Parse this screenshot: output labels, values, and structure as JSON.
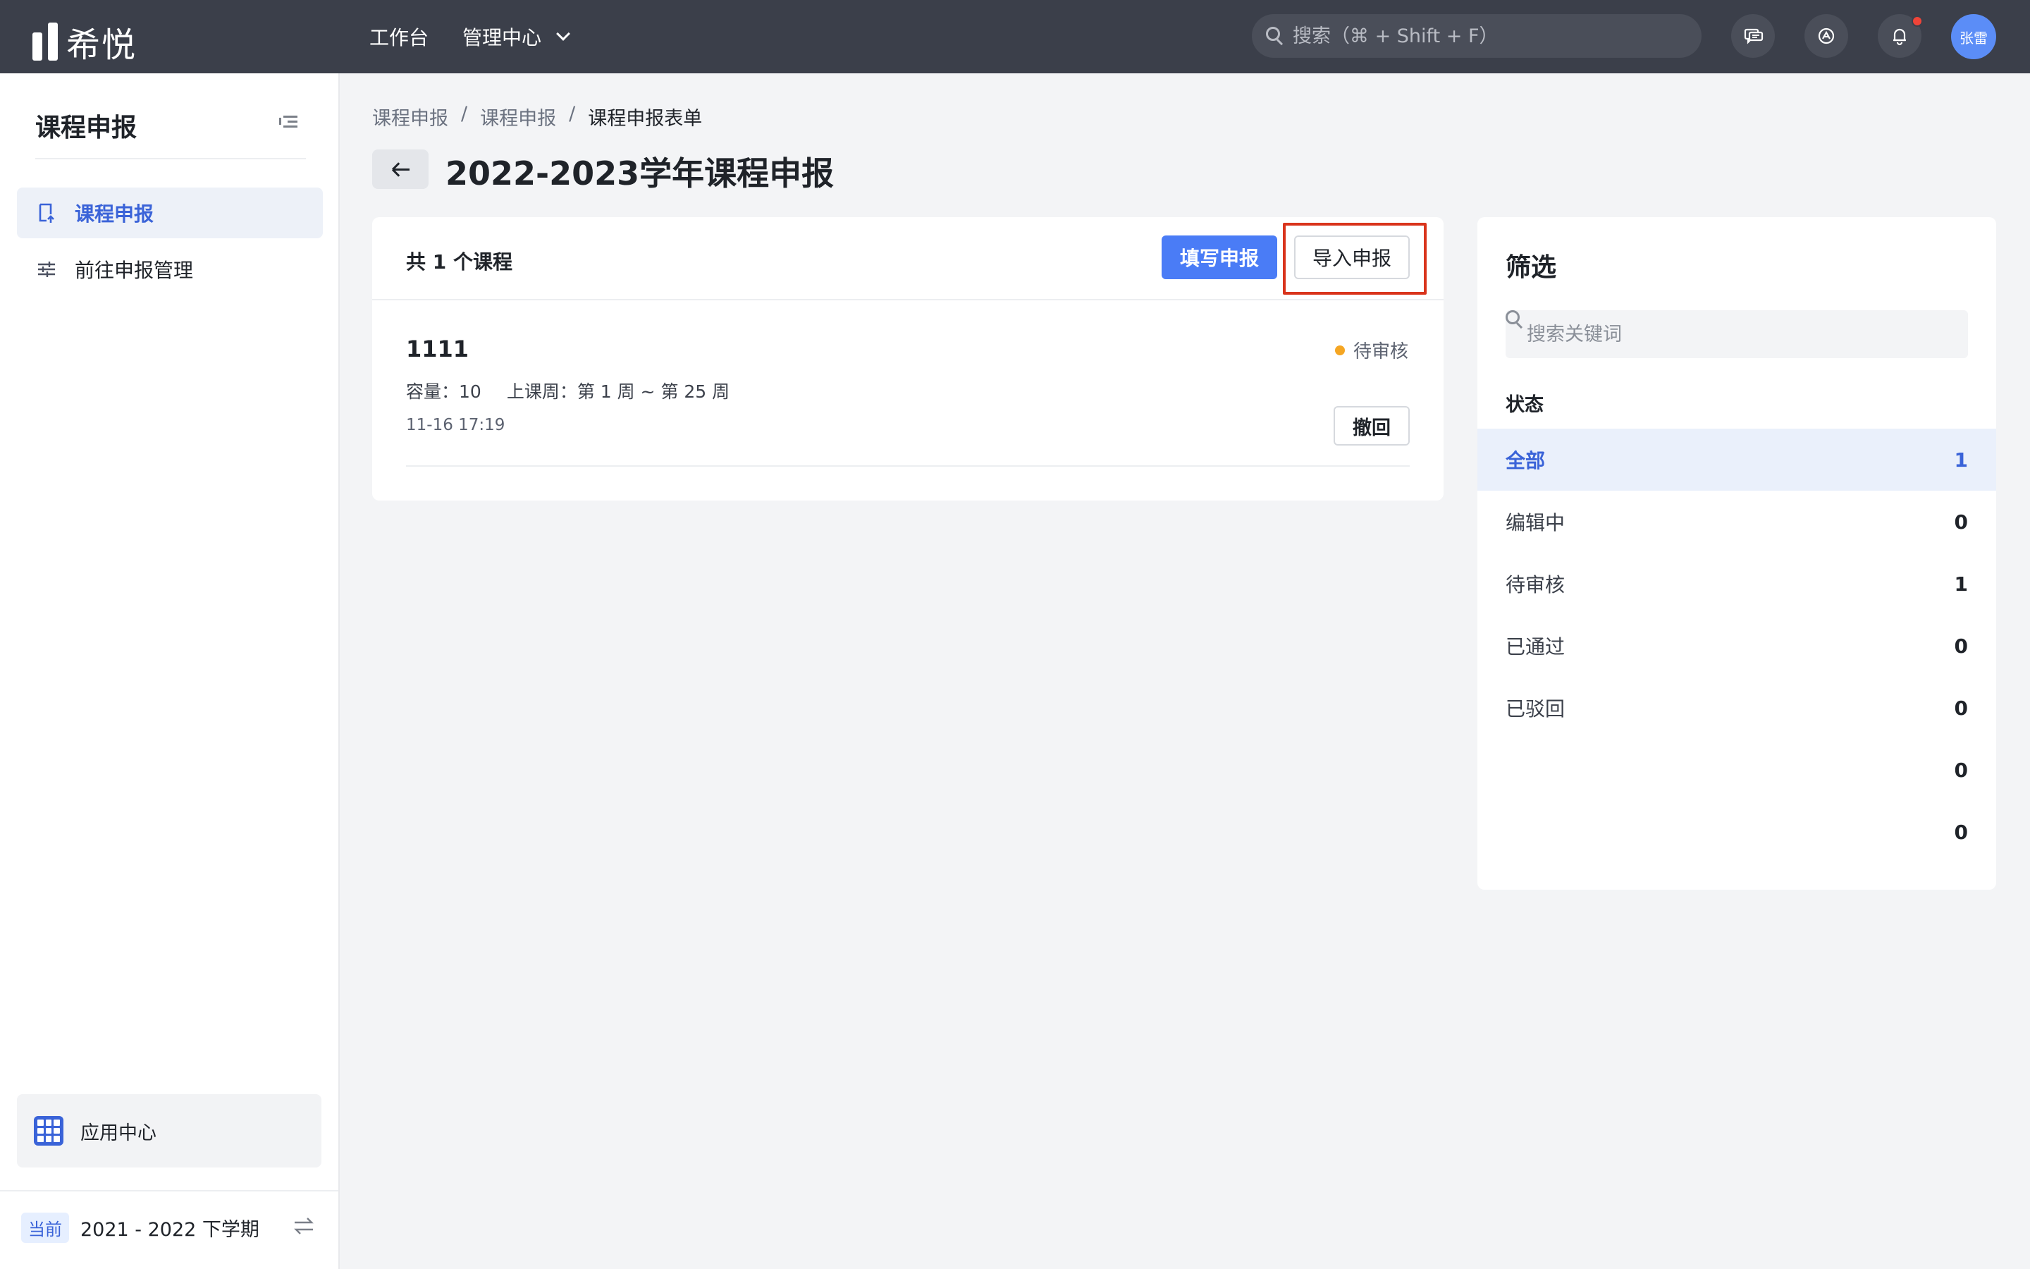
{
  "topbar": {
    "logo_text": "希悦",
    "nav": {
      "workbench": "工作台",
      "admin_center": "管理中心"
    },
    "search_placeholder": "搜索（⌘ + Shift + F）",
    "user_initials": "张雷"
  },
  "sidebar": {
    "title": "课程申报",
    "items": [
      {
        "label": "课程申报",
        "icon": "document-upload-icon",
        "active": true
      },
      {
        "label": "前往申报管理",
        "icon": "sliders-icon",
        "active": false
      }
    ],
    "app_center": "应用中心",
    "term_tag": "当前",
    "term": "2021 - 2022 下学期"
  },
  "breadcrumb": [
    "课程申报",
    "课程申报",
    "课程申报表单"
  ],
  "breadcrumb_sep": "/",
  "page_title": "2022-2023学年课程申报",
  "list": {
    "count_text": "共 1 个课程",
    "fill_button": "填写申报",
    "import_button": "导入申报",
    "courses": [
      {
        "name": "1111",
        "status": "待审核",
        "capacity": "容量：10",
        "weeks": "上课周：第 1 周 ~ 第 25 周",
        "time": "11-16 17:19",
        "withdraw": "撤回"
      }
    ]
  },
  "filter": {
    "title": "筛选",
    "search_placeholder": "搜索关键词",
    "section": "状态",
    "rows": [
      {
        "label": "全部",
        "count": "1",
        "active": true
      },
      {
        "label": "编辑中",
        "count": "0"
      },
      {
        "label": "待审核",
        "count": "1"
      },
      {
        "label": "已通过",
        "count": "0"
      },
      {
        "label": "已驳回",
        "count": "0"
      },
      {
        "label": "",
        "count": "0"
      },
      {
        "label": "",
        "count": "0"
      }
    ]
  },
  "colors": {
    "accent": "#4a7cf6",
    "topbar": "#3b3f4a",
    "pending": "#f5a623",
    "highlight_box": "#d9341c"
  }
}
